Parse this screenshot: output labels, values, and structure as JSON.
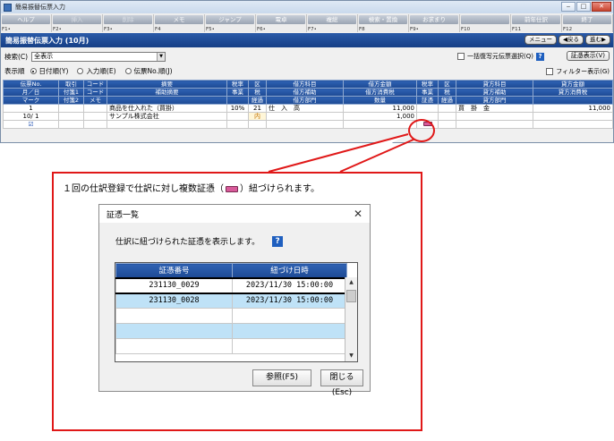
{
  "window": {
    "title": "簡易振替伝票入力",
    "controls": [
      "‒",
      "□",
      "✕"
    ]
  },
  "fkeys": [
    {
      "label": "ヘルプ",
      "num": "F1•",
      "enabled": true
    },
    {
      "label": "挿入",
      "num": "F2•",
      "enabled": false
    },
    {
      "label": "削除",
      "num": "F3•",
      "enabled": false
    },
    {
      "label": "メモ",
      "num": "F4",
      "enabled": true
    },
    {
      "label": "ジャンプ",
      "num": "F5•",
      "enabled": true
    },
    {
      "label": "電卓",
      "num": "F6•",
      "enabled": true
    },
    {
      "label": "複総",
      "num": "F7•",
      "enabled": true
    },
    {
      "label": "検索・置換",
      "num": "F8",
      "enabled": true
    },
    {
      "label": "お求まり",
      "num": "F9•",
      "enabled": true
    },
    {
      "label": "",
      "num": "F10",
      "enabled": true
    },
    {
      "label": "前年仕訳",
      "num": "F11",
      "enabled": true
    },
    {
      "label": "終了",
      "num": "F12",
      "enabled": true
    }
  ],
  "header": {
    "title": "簡易振替伝票入力 (10月)",
    "nav": [
      "メニュー",
      "◀戻る",
      "進む▶"
    ]
  },
  "search": {
    "label": "検索(C)",
    "value": "全表示",
    "bulk_label": "一括復写元伝票選択(Q)",
    "doc_button": "証憑表示(V)"
  },
  "order": {
    "label": "表示順",
    "options": [
      {
        "label": "日付順(Y)",
        "selected": true
      },
      {
        "label": "入力順(E)",
        "selected": false
      },
      {
        "label": "伝票No.順(J)",
        "selected": false
      }
    ],
    "filter_label": "フィルター表示(G)"
  },
  "grid": {
    "header_rows": [
      [
        "伝票No.",
        "取引",
        "コード",
        "摘要",
        "税率",
        "区",
        "借方科目",
        "借方金額",
        "税率",
        "区",
        "貸方科目",
        "貸方金額"
      ],
      [
        "月／日",
        "付箋1",
        "コード",
        "補助摘要",
        "事業",
        "税",
        "借方補助",
        "借方消費税",
        "事業",
        "税",
        "貸方補助",
        "貸方消費税"
      ],
      [
        "マーク",
        "付箋2",
        "メモ",
        "",
        "",
        "経過",
        "借方部門",
        "数量",
        "証憑",
        "経過",
        "貸方部門",
        ""
      ]
    ],
    "row1": {
      "no": "1",
      "summary": "商品を仕入れた（買掛）",
      "rate": "10%",
      "tax": "21",
      "debit_account": "仕　入　高",
      "debit_amount": "11,000",
      "credit_account": "買　掛　金",
      "credit_amount": "11,000"
    },
    "row2": {
      "date": "10/ 1",
      "sub_summary": "サンプル株式会社",
      "tax_flag": "内",
      "debit_tax": "1,000"
    },
    "row3": {
      "mark": "☑"
    }
  },
  "callout": {
    "text_before": "１回の仕訳登録で仕訳に対し複数証憑（",
    "text_after": "）紐づけられます。"
  },
  "dialog": {
    "title": "証憑一覧",
    "close": "✕",
    "message": "仕訳に紐づけられた証憑を表示します。",
    "help": "?",
    "columns": [
      "証憑番号",
      "紐づけ日時"
    ],
    "rows": [
      {
        "id": "231130_0029",
        "datetime": "2023/11/30 15:00:00"
      },
      {
        "id": "231130_0028",
        "datetime": "2023/11/30 15:00:00"
      }
    ],
    "ref_button": "参照(F5)",
    "close_button": "閉じる(Esc)"
  }
}
